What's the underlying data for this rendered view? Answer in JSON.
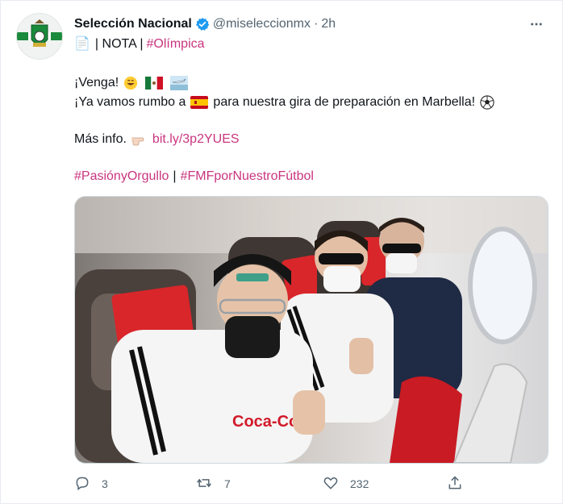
{
  "account": {
    "name": "Selección Nacional",
    "handle": "@miseleccionmx",
    "separator": "·",
    "time": "2h"
  },
  "tweet": {
    "line1_prefix": "📄",
    "line1_text": "| NOTA |",
    "line1_hashtag": "#Olímpica",
    "line2_text": "¡Venga!",
    "line3_text_a": "¡Ya vamos rumbo a",
    "line3_text_b": "para nuestra gira de preparación en Marbella!",
    "line4_text": "Más info.",
    "line4_link": "bit.ly/3p2YUES",
    "hashtag1": "#PasiónyOrgullo",
    "hashtag_separator": "|",
    "hashtag2": "#FMFporNuestroFútbol"
  },
  "metrics": {
    "replies": "3",
    "retweets": "7",
    "likes": "232"
  },
  "icons": {
    "verified": "verified-badge-icon",
    "more": "more-options-icon",
    "reply": "reply-icon",
    "retweet": "retweet-icon",
    "like": "heart-icon",
    "share": "share-icon"
  },
  "colors": {
    "hashtag": "#c9357f",
    "verified": "#1d9bf0",
    "secondary_text": "#536471"
  }
}
